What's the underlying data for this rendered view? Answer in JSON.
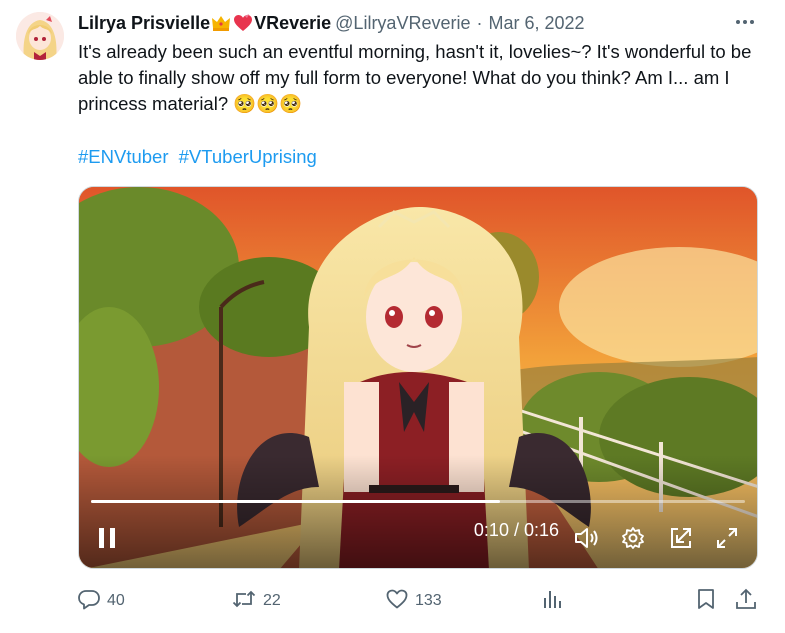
{
  "author": {
    "display_name": "Lilrya Prisvielle",
    "display_name_suffix": "VReverie",
    "handle": "@LilryaVReverie",
    "date": "Mar 6, 2022"
  },
  "tweet": {
    "text": "It's already been such an eventful morning, hasn't it, lovelies~? It's wonderful to be able to finally show off my full form to everyone! What do you think? Am I... am I princess material? 🥺🥺🥺",
    "hashtags": [
      "#ENVtuber",
      "#VTuberUprising"
    ]
  },
  "video": {
    "time_current": "0:10",
    "time_total": "0:16",
    "time_display": "0:10 / 0:16",
    "progress_fraction": 0.625,
    "state": "playing"
  },
  "actions": {
    "replies": "40",
    "retweets": "22",
    "likes": "133"
  },
  "colors": {
    "link": "#1d9bf0",
    "secondary_text": "#536471",
    "primary_text": "#0f1419"
  },
  "icons": [
    "more-icon",
    "crown-emoji",
    "heart-emoji",
    "pause-icon",
    "volume-icon",
    "settings-gear-icon",
    "pip-icon",
    "fullscreen-icon",
    "reply-icon",
    "retweet-icon",
    "like-icon",
    "views-icon",
    "bookmark-icon",
    "share-icon"
  ]
}
